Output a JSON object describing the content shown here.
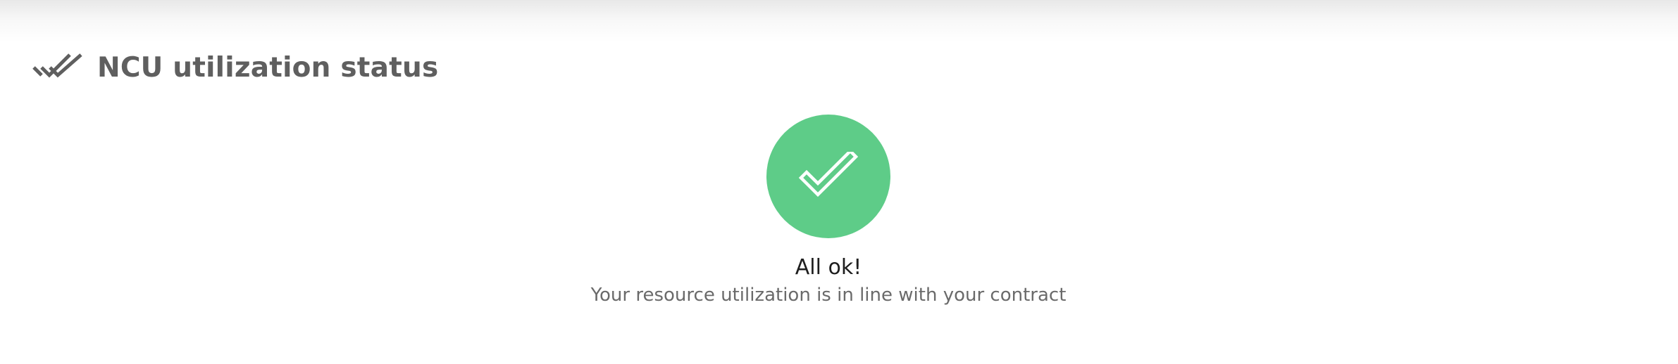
{
  "panel": {
    "title": "NCU utilization status",
    "title_icon": "double-check-icon",
    "title_color": "#5f5f5f"
  },
  "status": {
    "state": "ok",
    "icon": "check-icon",
    "circle_color": "#5ecc88",
    "heading": "All ok!",
    "message": "Your resource utilization is in line with your contract"
  }
}
